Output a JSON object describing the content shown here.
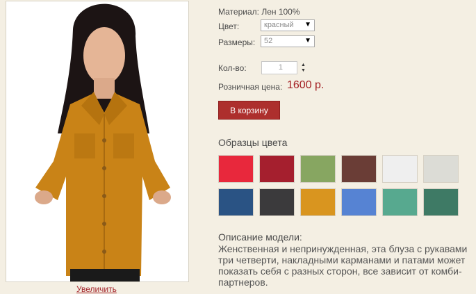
{
  "product": {
    "material_label": "Материал:",
    "material_value": "Лен 100%",
    "color_label": "Цвет:",
    "color_selected": "красный",
    "size_label": "Размеры:",
    "size_selected": "52",
    "qty_label": "Кол-во:",
    "qty_value": "1",
    "price_label": "Розничная цена:",
    "price_value": "1600 р.",
    "cart_button": "В корзину",
    "zoom_link": "Увеличить"
  },
  "swatches": {
    "title": "Образцы цвета",
    "colors": [
      "#e8283c",
      "#a51f2e",
      "#87a661",
      "#6a3d36",
      "#efefef",
      "#dcdcd6",
      "#2a5384",
      "#3b3a3c",
      "#d9951f",
      "#5683d3",
      "#57a98f",
      "#3e7a65"
    ]
  },
  "description": {
    "title": "Описание модели:",
    "text": "Женственная и непринужденная, эта блуза с рукавами три четверти, накладными карманами и патами может показать себя с разных сторон, все зависит от комби-партнеров."
  },
  "colors": {
    "accent": "#a31e22",
    "button": "#ad2f2d",
    "background": "#f4efe3"
  }
}
